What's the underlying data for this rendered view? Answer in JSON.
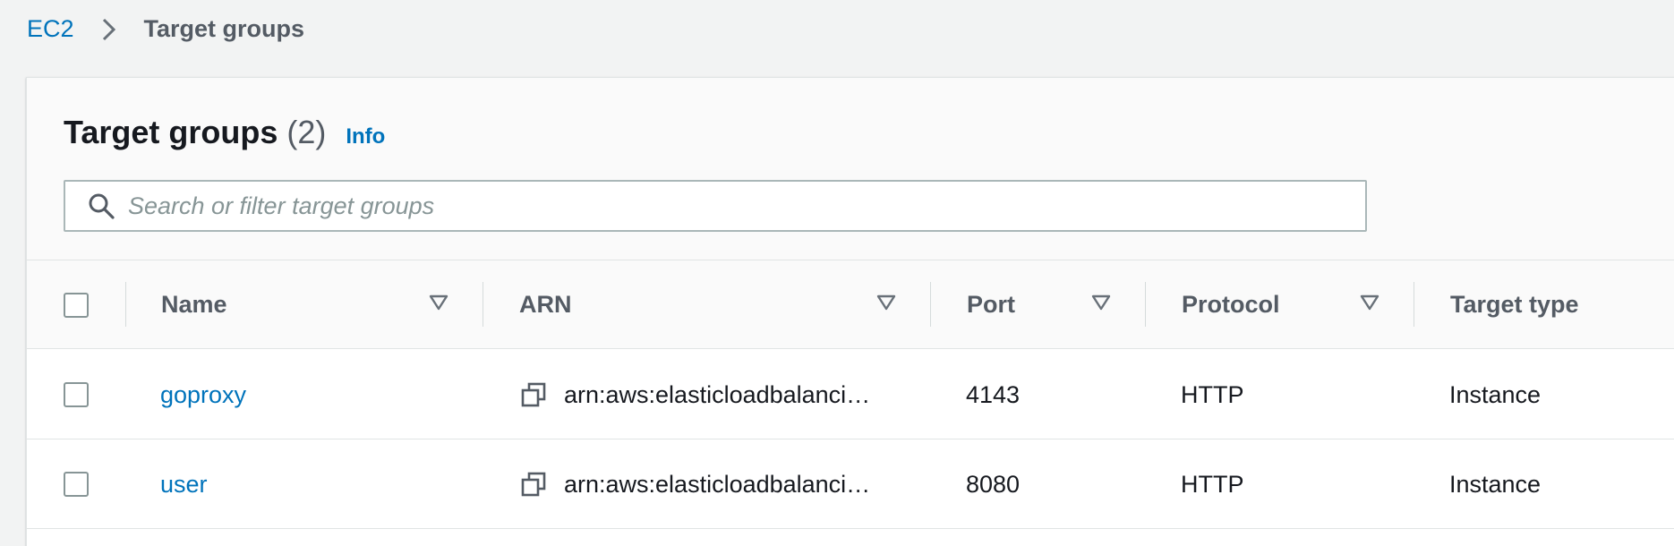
{
  "breadcrumb": {
    "root": "EC2",
    "current": "Target groups"
  },
  "panel": {
    "title": "Target groups",
    "count": "(2)",
    "info": "Info"
  },
  "search": {
    "placeholder": "Search or filter target groups",
    "value": ""
  },
  "table": {
    "columns": {
      "name": "Name",
      "arn": "ARN",
      "port": "Port",
      "protocol": "Protocol",
      "target_type": "Target type"
    },
    "rows": [
      {
        "name": "goproxy",
        "arn": "arn:aws:elasticloadbalanci…",
        "port": "4143",
        "protocol": "HTTP",
        "target_type": "Instance"
      },
      {
        "name": "user",
        "arn": "arn:aws:elasticloadbalanci…",
        "port": "8080",
        "protocol": "HTTP",
        "target_type": "Instance"
      }
    ]
  },
  "icons": {
    "breadcrumb_separator": "chevron-right-icon",
    "search": "search-icon",
    "sort": "sort-caret-down-icon",
    "copy": "copy-icon"
  },
  "colors": {
    "link": "#0073bb",
    "text": "#16191f",
    "muted": "#545b64",
    "background": "#f2f3f3"
  }
}
